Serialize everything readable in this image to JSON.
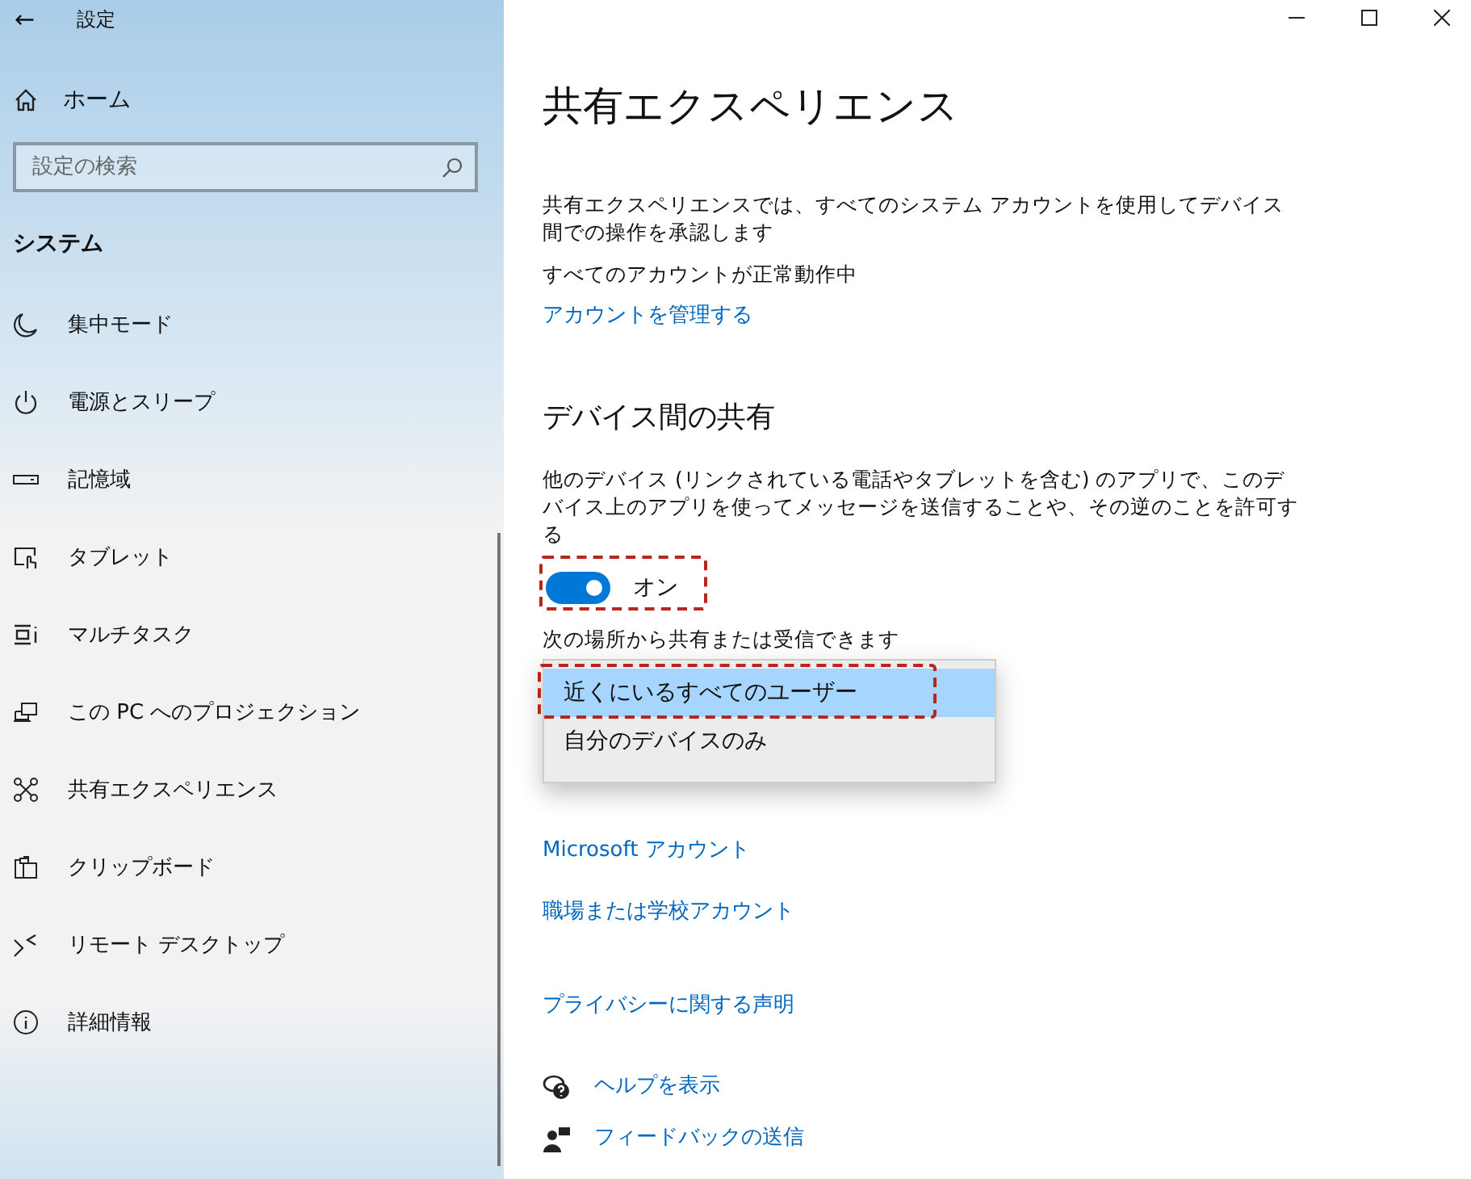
{
  "window": {
    "title": "設定",
    "back": "←"
  },
  "sidebar": {
    "home": "ホーム",
    "search": {
      "placeholder": "設定の検索"
    },
    "section": "システム",
    "items": [
      {
        "label": "集中モード",
        "selected": false
      },
      {
        "label": "電源とスリープ",
        "selected": false
      },
      {
        "label": "記憶域",
        "selected": false
      },
      {
        "label": "タブレット",
        "selected": false
      },
      {
        "label": "マルチタスク",
        "selected": false
      },
      {
        "label": "この PC へのプロジェクション",
        "selected": false
      },
      {
        "label": "共有エクスペリエンス",
        "selected": false
      },
      {
        "label": "クリップボード",
        "selected": false
      },
      {
        "label": "リモート デスクトップ",
        "selected": false
      },
      {
        "label": "詳細情報",
        "selected": false
      }
    ]
  },
  "page": {
    "title": "共有エクスペリエンス",
    "account_text": "共有エクスペリエンスでは、すべてのシステム アカウントを使用してデバイス間での操作を承認します",
    "account_status": "すべてのアカウントが正常動作中",
    "manage_link": "アカウントを管理する",
    "share_heading": "デバイス間の共有",
    "share_text": "他のデバイス (リンクされている電話やタブレットを含む) のアプリで、このデバイス上のアプリを使ってメッセージを送信することや、その逆のことを許可する",
    "toggle": {
      "on": true,
      "label": "オン",
      "highlighted": true
    },
    "receive_label": "次の場所から共有または受信できます",
    "dropdown": [
      {
        "label": "近くにいるすべてのユーザー",
        "selected": true,
        "highlighted": true
      },
      {
        "label": "自分のデバイスのみ",
        "selected": false,
        "highlighted": false
      }
    ],
    "links": [
      "Microsoft アカウント",
      "職場または学校アカウント"
    ],
    "privacy_link": "プライバシーに関する声明",
    "help": [
      "ヘルプを表示",
      "フィードバックの送信"
    ]
  }
}
